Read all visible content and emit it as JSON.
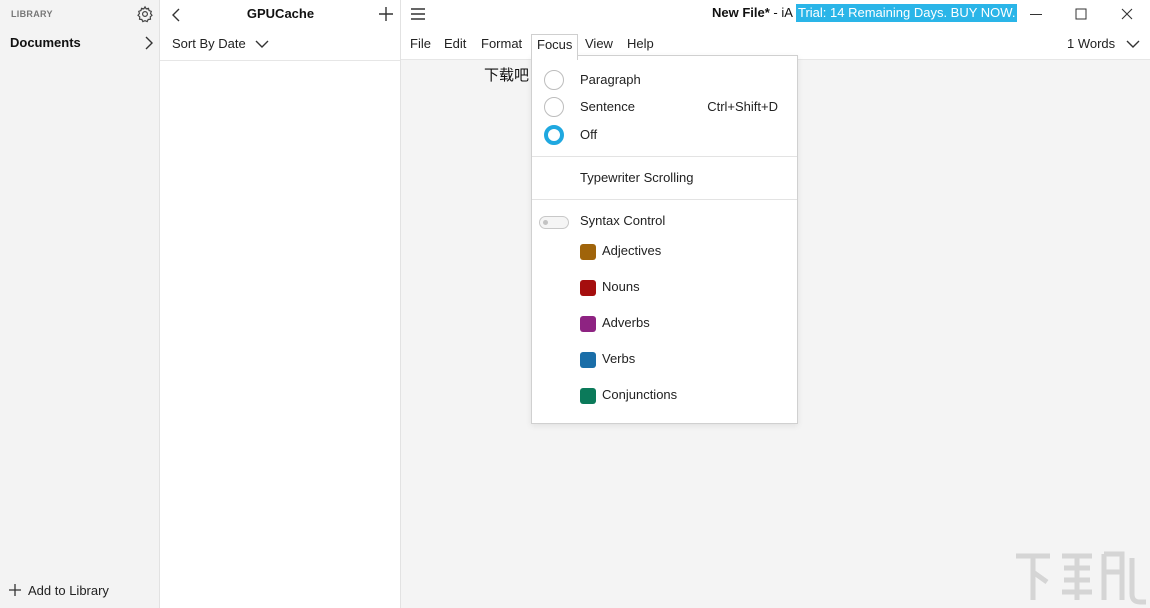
{
  "library": {
    "header": "LIBRARY",
    "documents_label": "Documents",
    "add_label": "Add to Library"
  },
  "doclist": {
    "title": "GPUCache",
    "sort_label": "Sort By Date"
  },
  "window": {
    "title": "New File*",
    "title_suffix": "- iA",
    "trial_banner": "Trial: 14 Remaining Days. BUY NOW."
  },
  "menubar": {
    "items": [
      "File",
      "Edit",
      "Format",
      "Focus",
      "View",
      "Help"
    ],
    "active": "Focus",
    "word_count": "1 Words"
  },
  "editor": {
    "text": "下载吧"
  },
  "focus_menu": {
    "modes": [
      {
        "label": "Paragraph",
        "shortcut": "",
        "checked": false
      },
      {
        "label": "Sentence",
        "shortcut": "Ctrl+Shift+D",
        "checked": false
      },
      {
        "label": "Off",
        "shortcut": "",
        "checked": true
      }
    ],
    "typewriter_label": "Typewriter Scrolling",
    "syntax_control": {
      "label": "Syntax Control",
      "enabled": false,
      "items": [
        {
          "label": "Adjectives",
          "color": "#a0640a"
        },
        {
          "label": "Nouns",
          "color": "#a50e0e"
        },
        {
          "label": "Adverbs",
          "color": "#8e2382"
        },
        {
          "label": "Verbs",
          "color": "#1a6ea8"
        },
        {
          "label": "Conjunctions",
          "color": "#0b7a5a"
        }
      ]
    }
  },
  "accent_color": "#1fa8e0",
  "trial_color": "#2ab5e8"
}
